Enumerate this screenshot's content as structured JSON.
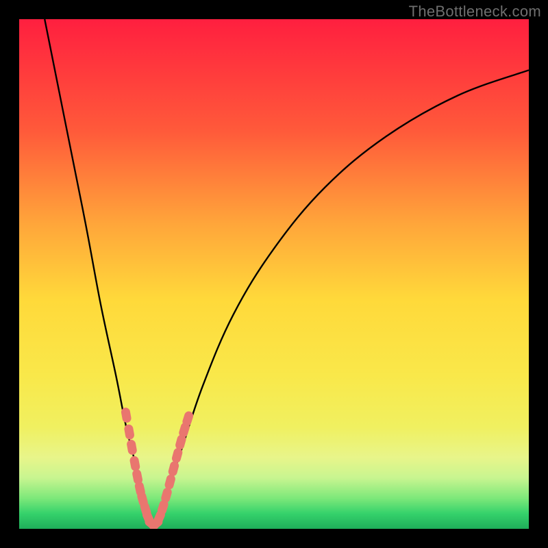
{
  "watermark": "TheBottleneck.com",
  "chart_data": {
    "type": "line",
    "title": "",
    "xlabel": "",
    "ylabel": "",
    "xlim": [
      0,
      100
    ],
    "ylim": [
      0,
      100
    ],
    "grid": false,
    "series": [
      {
        "name": "bottleneck-curve",
        "x": [
          5,
          9,
          13,
          16,
          19,
          21,
          23,
          24,
          25,
          26,
          27,
          28,
          29,
          32,
          36,
          42,
          50,
          60,
          72,
          86,
          100
        ],
        "y": [
          100,
          80,
          60,
          44,
          30,
          20,
          12,
          7,
          3,
          1,
          1,
          3,
          7,
          16,
          28,
          42,
          55,
          67,
          77,
          85,
          90
        ]
      }
    ],
    "markers": {
      "name": "highlighted-points",
      "color": "#e9766f",
      "points": [
        {
          "x": 21.0,
          "y": 22.3
        },
        {
          "x": 21.6,
          "y": 19.0
        },
        {
          "x": 22.1,
          "y": 16.0
        },
        {
          "x": 22.7,
          "y": 12.8
        },
        {
          "x": 23.2,
          "y": 10.2
        },
        {
          "x": 23.7,
          "y": 7.8
        },
        {
          "x": 24.2,
          "y": 5.8
        },
        {
          "x": 24.8,
          "y": 3.8
        },
        {
          "x": 25.3,
          "y": 2.2
        },
        {
          "x": 26.0,
          "y": 1.0
        },
        {
          "x": 26.8,
          "y": 1.0
        },
        {
          "x": 27.5,
          "y": 2.2
        },
        {
          "x": 28.2,
          "y": 4.2
        },
        {
          "x": 28.9,
          "y": 6.6
        },
        {
          "x": 29.6,
          "y": 9.2
        },
        {
          "x": 30.3,
          "y": 11.8
        },
        {
          "x": 31.0,
          "y": 14.4
        },
        {
          "x": 31.7,
          "y": 17.0
        },
        {
          "x": 32.4,
          "y": 19.4
        },
        {
          "x": 33.1,
          "y": 21.6
        }
      ]
    }
  },
  "colors": {
    "marker": "#e9766f",
    "curve": "#000000",
    "background_top": "#ff1f3f",
    "background_bottom": "#1fae5a",
    "frame": "#000000"
  }
}
